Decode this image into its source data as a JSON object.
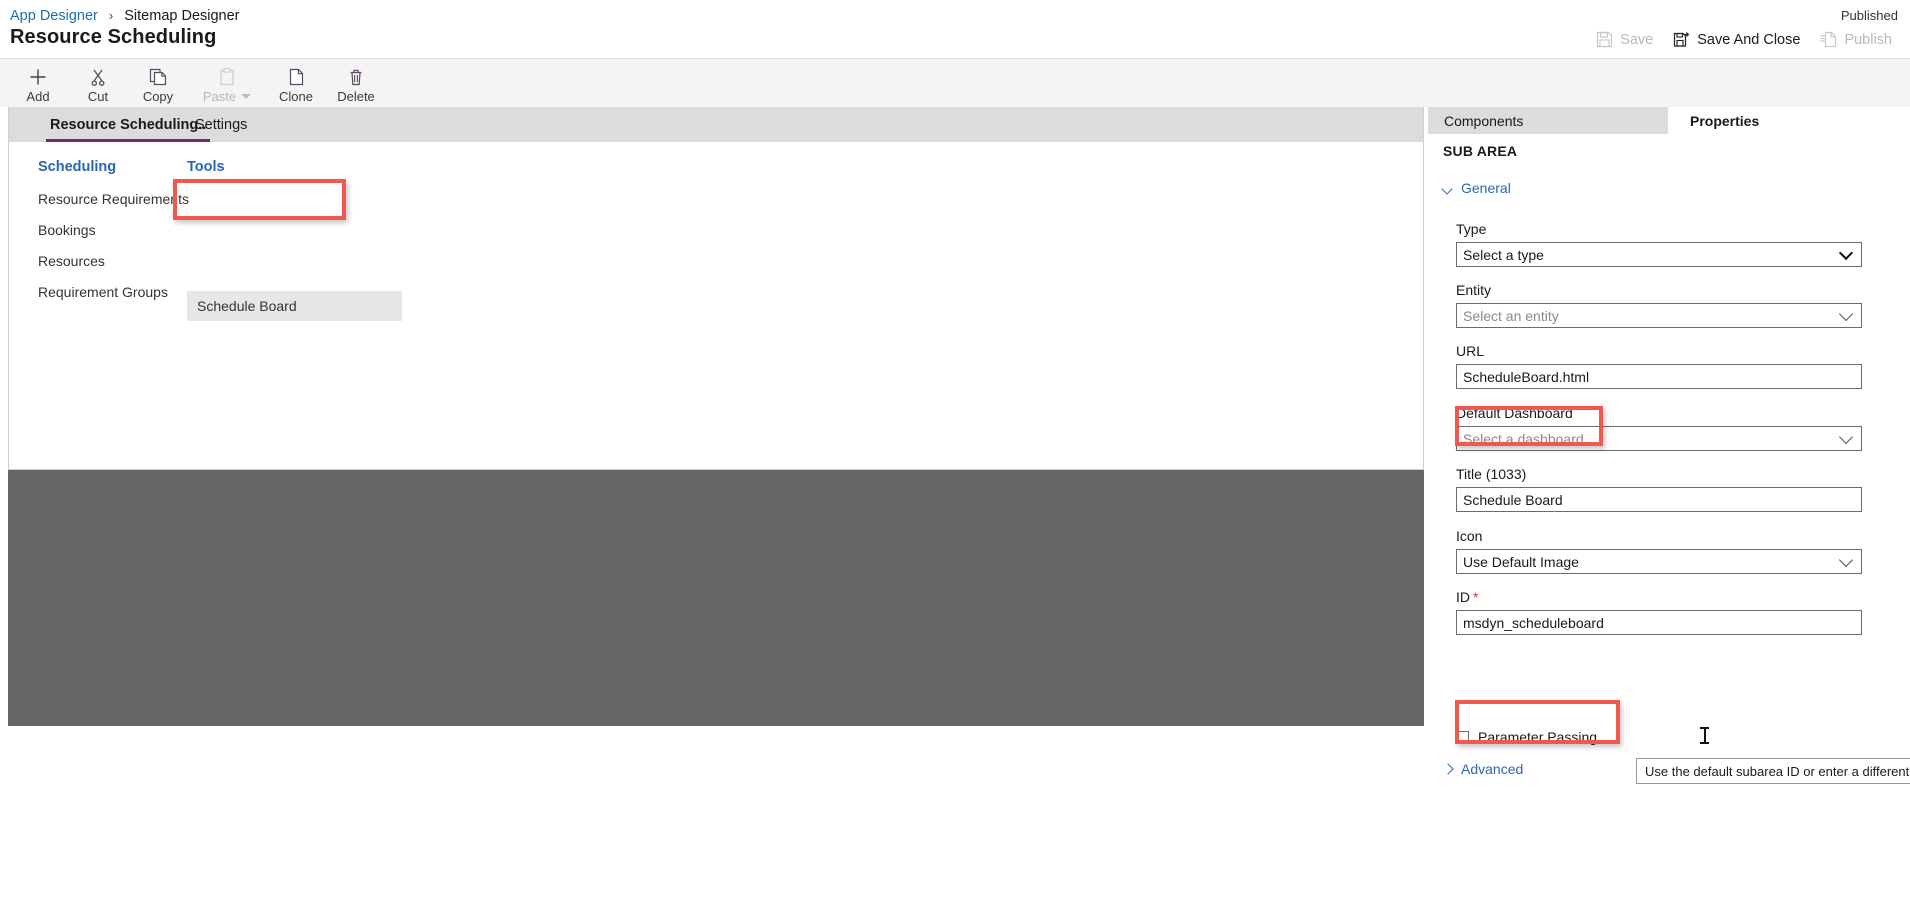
{
  "header": {
    "breadcrumb": {
      "parent": "App Designer",
      "separator": "›",
      "current": "Sitemap Designer"
    },
    "page_title": "Resource Scheduling",
    "published_status": "Published",
    "actions": [
      {
        "label": "Save",
        "icon": "save-icon",
        "disabled": true
      },
      {
        "label": "Save And Close",
        "icon": "save-and-close-icon",
        "disabled": false
      },
      {
        "label": "Publish",
        "icon": "publish-icon",
        "disabled": true
      }
    ]
  },
  "command_bar": {
    "items": [
      {
        "label": "Add",
        "icon": "plus-icon",
        "disabled": false
      },
      {
        "label": "Cut",
        "icon": "scissors-icon",
        "disabled": false
      },
      {
        "label": "Copy",
        "icon": "copy-icon",
        "disabled": false
      },
      {
        "label": "Paste",
        "icon": "clipboard-icon",
        "disabled": true,
        "has_caret": true
      },
      {
        "label": "Clone",
        "icon": "clone-icon",
        "disabled": false
      },
      {
        "label": "Delete",
        "icon": "trash-icon",
        "disabled": false
      }
    ]
  },
  "designer": {
    "tabs": [
      {
        "label": "Resource Scheduling..",
        "active": true
      },
      {
        "label": "Settings",
        "active": false
      }
    ],
    "groups": [
      {
        "title": "Scheduling",
        "items": [
          "Resource Requirements",
          "Bookings",
          "Resources",
          "Requirement Groups"
        ]
      },
      {
        "title": "Tools",
        "items": [
          "Schedule Board"
        ]
      }
    ],
    "selected_tile": "Schedule Board"
  },
  "properties_panel": {
    "tabs": [
      {
        "label": "Components",
        "active": false
      },
      {
        "label": "Properties",
        "active": true
      }
    ],
    "section_title": "SUB AREA",
    "general_section": {
      "label": "General",
      "expanded": true
    },
    "advanced_section": {
      "label": "Advanced",
      "expanded": false
    },
    "fields": {
      "type": {
        "label": "Type",
        "value": "Select a type",
        "is_placeholder": false,
        "control": "select"
      },
      "entity": {
        "label": "Entity",
        "value": "Select an entity",
        "is_placeholder": true,
        "control": "combo"
      },
      "url": {
        "label": "URL",
        "value": "ScheduleBoard.html",
        "is_placeholder": false,
        "control": "text"
      },
      "default_dashboard": {
        "label": "Default Dashboard",
        "value": "Select a dashboard",
        "is_placeholder": true,
        "control": "combo"
      },
      "title": {
        "label": "Title (1033)",
        "value": "Schedule Board",
        "is_placeholder": false,
        "control": "text"
      },
      "icon": {
        "label": "Icon",
        "value": "Use Default Image",
        "is_placeholder": false,
        "control": "combo"
      },
      "id": {
        "label": "ID",
        "required_marker": "*",
        "value": "msdyn_scheduleboard",
        "is_placeholder": false,
        "control": "text"
      },
      "parameter_passing": {
        "label": "Parameter Passing",
        "checked": false
      }
    },
    "tooltip": "Use the default subarea ID or enter a different one."
  },
  "colors": {
    "accent_purple": "#742774",
    "link_blue": "#2a66b5",
    "highlight_red": "#f1594e",
    "overlay_gray": "#666666",
    "tab_gray": "#dcdcdc",
    "required_red": "#d13438"
  }
}
